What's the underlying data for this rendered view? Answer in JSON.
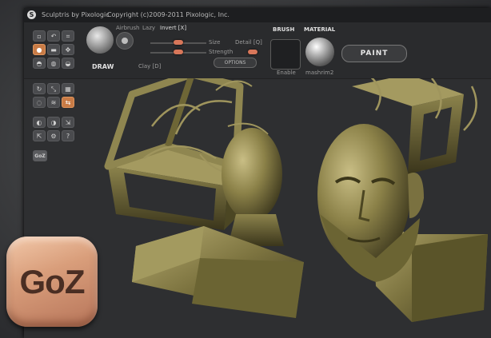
{
  "titlebar": {
    "app": "Sculptris by Pixologic",
    "copyright": "Copyright (c)2009-2011 Pixologic, Inc."
  },
  "brush": {
    "tool_label": "DRAW",
    "airbrush": "Airbrush",
    "lazy": "Lazy",
    "invert": "Invert [X]",
    "clay": "Clay [D]",
    "size": "Size",
    "strength": "Strength",
    "detail": "Detail [Q]",
    "options": "OPTIONS",
    "size_level": 0.5,
    "strength_level": 0.5
  },
  "brush_panel": {
    "heading": "BRUSH",
    "enable": "Enable"
  },
  "material_panel": {
    "heading": "MATERIAL",
    "name": "mashrim2"
  },
  "paint_button": "PAINT",
  "sidebar": {
    "goz_label": "GoZ"
  },
  "overlay": {
    "goz_logo": "GoZ"
  },
  "colors": {
    "accent": "#c87b46",
    "sculpt": "#7d7440",
    "background": "#2e2f31"
  }
}
